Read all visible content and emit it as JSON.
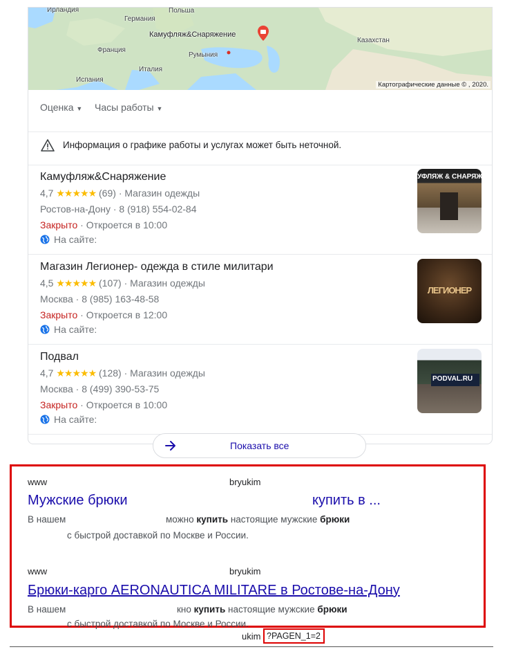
{
  "map": {
    "labels": [
      "Ирландия",
      "Германия",
      "Польша",
      "Камуфляж&Снаряжение",
      "Франция",
      "Румыния",
      "Италия",
      "Испания",
      "Казахстан"
    ],
    "copyright": "Картографические данные ©‎ , 2020."
  },
  "filters": [
    "Оценка",
    "Часы работы"
  ],
  "warning": "Информация о графике работы и услугах может быть неточной.",
  "places": [
    {
      "name": "Камуфляж&Снаряжение",
      "rating": "4,7",
      "stars": "★★★★★",
      "count": "(69)",
      "category": "· Магазин одежды",
      "address": "Ростов-на-Дону · 8 (918) 554-02-84",
      "status": "Закрыто",
      "opens": " · Откроется в 10:00",
      "site": "На сайте:",
      "thumb_text": "УФЛЯЖ & СНАРЯЖ"
    },
    {
      "name": "Магазин Легионер- одежда в стиле милитари",
      "rating": "4,5",
      "stars": "★★★★★",
      "count": "(107)",
      "category": "· Магазин одежды",
      "address": "Москва · 8 (985) 163-48-58",
      "status": "Закрыто",
      "opens": " · Откроется в 12:00",
      "site": "На сайте:",
      "thumb_text": "ЛЕГИОНЕР"
    },
    {
      "name": "Подвал",
      "rating": "4,7",
      "stars": "★★★★★",
      "count": "(128)",
      "category": "· Магазин одежды",
      "address": "Москва · 8 (499) 390-53-75",
      "status": "Закрыто",
      "opens": " · Откроется в 10:00",
      "site": "На сайте:",
      "thumb_text": "PODVAL.RU"
    }
  ],
  "show_all": "Показать все",
  "results": [
    {
      "url_left": "www",
      "url_right": "bryukim",
      "title_left": "Мужские брюки",
      "title_right": "купить в ...",
      "snip1_a": "В нашем",
      "snip1_b": "можно",
      "snip1_c": "купить",
      "snip1_d": "настоящие мужские",
      "snip1_e": "брюки",
      "snip2": "с быстрой доставкой по Москве и России."
    },
    {
      "url_left": "www",
      "url_right": "bryukim",
      "title": "Брюки-карго AERONAUTICA MILITARE в Ростове-на-Дону",
      "snip1_a": "В нашем",
      "snip1_b": "кно",
      "snip1_c": "купить",
      "snip1_d": "настоящие мужские",
      "snip1_e": "брюки",
      "snip2": "с быстрой доставкой по Москве и России."
    }
  ],
  "footer": {
    "prefix": "ukim",
    "param": "?PAGEN_1=2"
  },
  "colors": {
    "link": "#1a0dab",
    "closed": "#c5221f",
    "star": "#fbbc04",
    "highlight": "#dd0000"
  }
}
